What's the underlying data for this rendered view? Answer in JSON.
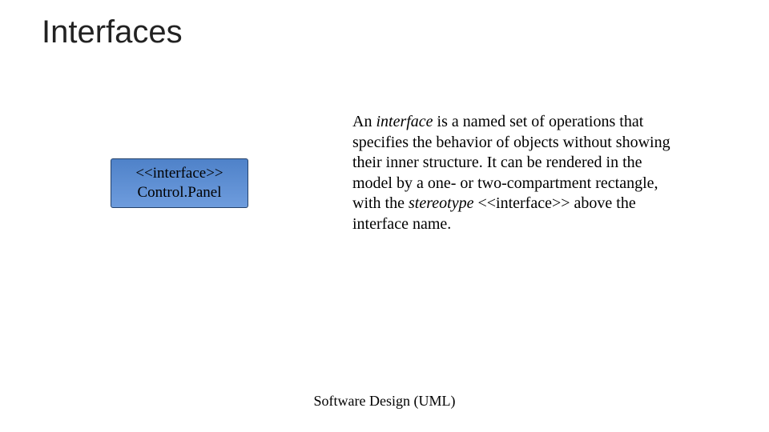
{
  "slide": {
    "title": "Interfaces",
    "footer": "Software Design (UML)"
  },
  "uml": {
    "stereotype_line": "<<interface>>",
    "name_line": "Control.Panel"
  },
  "desc": {
    "p1_a": "An ",
    "p1_b_italic": "interface",
    "p1_c": " is a named set of operations that specifies the behavior of objects without showing their inner structure. It can be rendered in the model by a one- or two-compartment rectangle, with the ",
    "p1_d_italic": "stereotype",
    "p1_e": " <<interface>> above the interface name."
  }
}
